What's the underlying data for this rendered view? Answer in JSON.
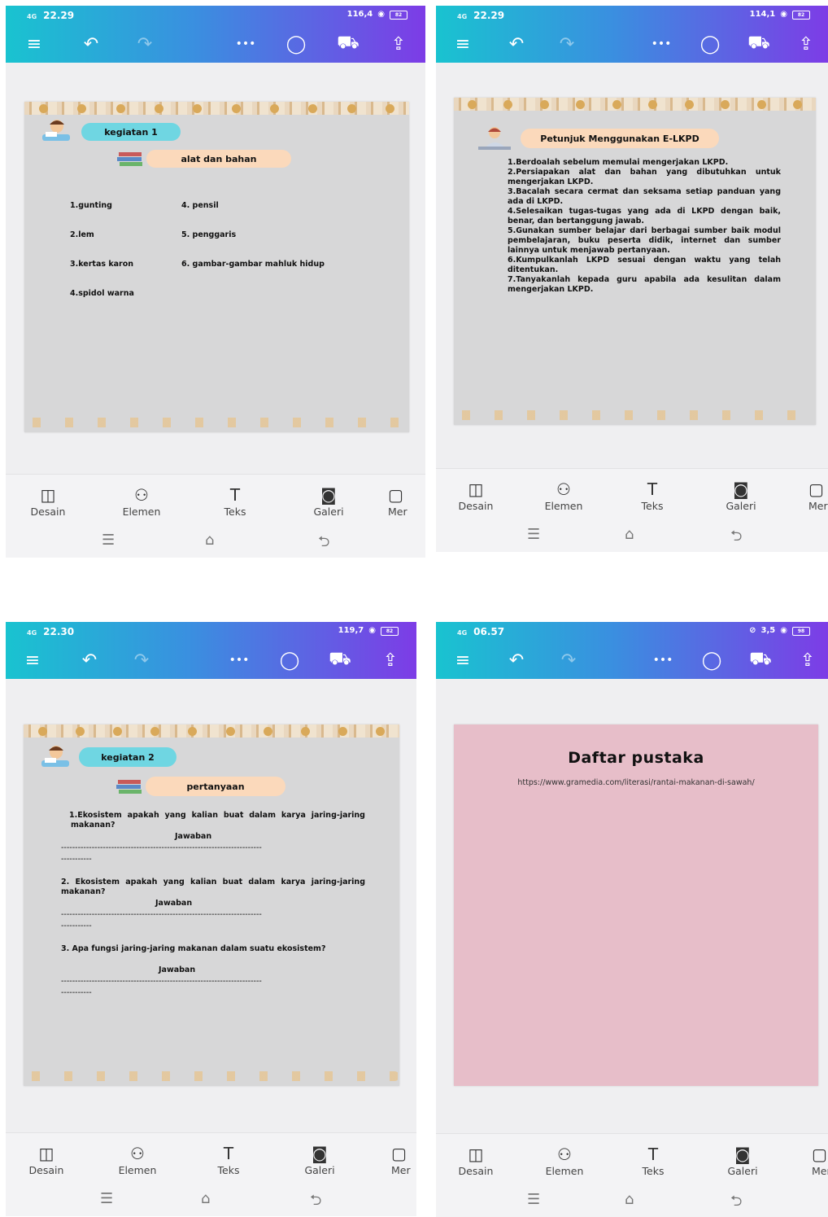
{
  "toolbar": {
    "menu_icon": "hamburger-icon",
    "undo_icon": "undo-icon",
    "redo_icon": "redo-icon",
    "more_label": "•••",
    "comment_icon": "comment-icon",
    "truck_icon": "delivery-truck-icon",
    "share_icon": "upload-icon"
  },
  "tools": [
    {
      "label": "Desain",
      "icon": "◫"
    },
    {
      "label": "Elemen",
      "icon": "⚇"
    },
    {
      "label": "Teks",
      "icon": "T"
    },
    {
      "label": "Galeri",
      "icon": "◙"
    },
    {
      "label": "Mer",
      "icon": "▢"
    }
  ],
  "screens": [
    {
      "status_time": "22.29",
      "status_net": "4G",
      "status_speed": "116,4",
      "battery": "82",
      "pill1": "kegiatan 1",
      "pill2": "alat dan bahan",
      "left_list": [
        "1.gunting",
        "2.lem",
        "3.kertas karon",
        "4.spidol warna"
      ],
      "right_list": [
        "4. pensil",
        "5. penggaris",
        "6. gambar-gambar mahluk hidup"
      ]
    },
    {
      "status_time": "22.29",
      "status_net": "4G",
      "status_speed": "114,1",
      "battery": "82",
      "pill1": "Petunjuk Menggunakan E-LKPD",
      "items": [
        "1.Berdoalah sebelum memulai mengerjakan LKPD.",
        "2.Persiapakan alat dan bahan yang dibutuhkan untuk mengerjakan LKPD.",
        "3.Bacalah secara cermat dan seksama setiap panduan yang ada di LKPD.",
        "4.Selesaikan tugas-tugas yang ada di LKPD dengan baik, benar, dan bertanggung jawab.",
        "5.Gunakan sumber belajar dari berbagai sumber baik modul pembelajaran, buku peserta didik, internet dan sumber lainnya untuk menjawab pertanyaan.",
        "6.Kumpulkanlah LKPD sesuai dengan waktu yang telah ditentukan.",
        "7.Tanyakanlah kepada guru apabila ada kesulitan dalam mengerjakan LKPD."
      ]
    },
    {
      "status_time": "22.30",
      "status_net": "4G",
      "status_speed": "119,7",
      "battery": "82",
      "pill1": "kegiatan 2",
      "pill2": "pertanyaan",
      "q1": "1.Ekosistem apakah yang kalian buat dalam karya jaring-jaring makanan?",
      "q2": "2. Ekosistem apakah yang kalian buat dalam karya jaring-jaring makanan?",
      "q3": "3. Apa fungsi jaring-jaring makanan dalam suatu ekosistem?",
      "answer_label": "Jawaban",
      "dash_line": "------------------------------------------------------------------------",
      "dash_short": "-----------"
    },
    {
      "status_time": "06.57",
      "status_net": "4G",
      "status_speed": "3,5",
      "battery": "98",
      "title": "Daftar pustaka",
      "url": "https://www.gramedia.com/literasi/rantai-makanan-di-sawah/"
    }
  ]
}
